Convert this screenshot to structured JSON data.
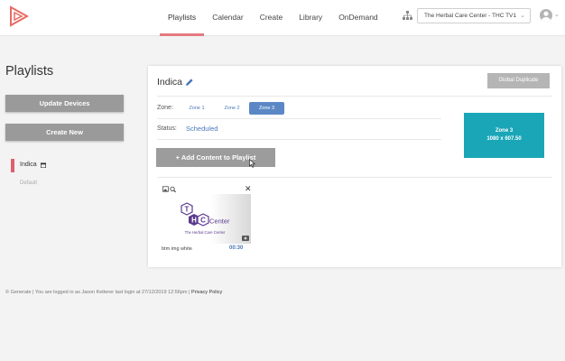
{
  "nav": {
    "items": [
      {
        "label": "Playlists",
        "active": true
      },
      {
        "label": "Calendar",
        "active": false
      },
      {
        "label": "Create",
        "active": false
      },
      {
        "label": "Library",
        "active": false
      },
      {
        "label": "OnDemand",
        "active": false
      }
    ]
  },
  "location": {
    "selected": "The Herbal Care Center - THC TV1",
    "icon": "location-tree-icon"
  },
  "sidebar": {
    "title": "Playlists",
    "update_label": "Update Devices",
    "create_label": "Create New",
    "playlists": [
      {
        "label": "Indica",
        "active": true,
        "icon": "calendar-icon"
      },
      {
        "label": "Default",
        "active": false
      }
    ]
  },
  "playlist": {
    "name": "Indica",
    "global_duplicate_label": "Global Duplicate",
    "zone_label": "Zone:",
    "zones": [
      "Zone 1",
      "Zone 2",
      "Zone 3"
    ],
    "active_zone": "Zone 3",
    "status_label": "Status:",
    "status_value": "Scheduled",
    "zone_preview": {
      "name": "Zone 3",
      "size": "1080 x 607.50",
      "color": "#1aa6b7"
    },
    "add_content_label": "+ Add Content to Playlist",
    "content": [
      {
        "caption": "btm img white",
        "duration": "00:30",
        "logo": {
          "letters": [
            "T",
            "H",
            "C"
          ],
          "word": "Center",
          "subtitle": "The Herbal Care Center"
        }
      }
    ]
  },
  "footer": {
    "text": "© Generate | You are logged in as Jason Ketterer last login at 27/12/2019 12:56pm |",
    "link": "Privacy Policy"
  },
  "colors": {
    "accent": "#e47a80",
    "link": "#4a78b8",
    "zone_active": "#5b88c5",
    "purple": "#5b3a8e"
  }
}
